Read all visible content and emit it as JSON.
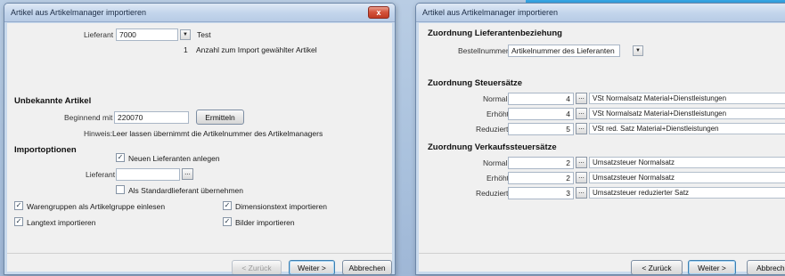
{
  "left_window": {
    "title": "Artikel aus Artikelmanager importieren",
    "close_label": "x",
    "lieferant_label": "Lieferant",
    "lieferant_value": "7000",
    "lieferant_name": "Test",
    "count_value": "1",
    "count_label": "Anzahl zum Import gewählter Artikel",
    "unbekannte_heading": "Unbekannte Artikel",
    "beginnend_label": "Beginnend mit",
    "beginnend_value": "220070",
    "ermitteln_label": "Ermitteln",
    "hinweis_label": "Hinweis:",
    "hinweis_text": "Leer lassen übernimmt die Artikelnummer des Artikelmanagers",
    "importoptionen_heading": "Importoptionen",
    "neuen_lieferanten_label": "Neuen Lieferanten anlegen",
    "lieferant2_label": "Lieferant",
    "lieferant2_value": "",
    "standardlieferant_label": "Als Standardlieferant übernehmen",
    "warengruppen_label": "Warengruppen als Artikelgruppe einlesen",
    "dimensionstext_label": "Dimensionstext importieren",
    "langtext_label": "Langtext importieren",
    "bilder_label": "Bilder importieren",
    "zurueck_label": "< Zurück",
    "weiter_label": "Weiter >",
    "abbrechen_label": "Abbrechen"
  },
  "right_window": {
    "title": "Artikel aus Artikelmanager importieren",
    "zuordnung_lieferant_heading": "Zuordnung Lieferantenbeziehung",
    "bestellnummer_label": "Bestellnummer",
    "bestellnummer_value": "Artikelnummer des Lieferanten",
    "steuersaetze_heading": "Zuordnung Steuersätze",
    "steuer_rows": [
      {
        "label": "Normal",
        "value": "4",
        "desc": "VSt Normalsatz Material+Dienstleistungen"
      },
      {
        "label": "Erhöht",
        "value": "4",
        "desc": "VSt Normalsatz Material+Dienstleistungen"
      },
      {
        "label": "Reduziert",
        "value": "5",
        "desc": "VSt red. Satz Material+Dienstleistungen"
      }
    ],
    "verkauf_heading": "Zuordnung Verkaufssteuersätze",
    "verkauf_rows": [
      {
        "label": "Normal",
        "value": "2",
        "desc": "Umsatzsteuer Normalsatz"
      },
      {
        "label": "Erhöht",
        "value": "2",
        "desc": "Umsatzsteuer Normalsatz"
      },
      {
        "label": "Reduziert",
        "value": "3",
        "desc": "Umsatzsteuer reduzierter Satz"
      }
    ],
    "zurueck_label": "< Zurück",
    "weiter_label": "Weiter >",
    "abbrechen_label": "Abbrechen"
  }
}
